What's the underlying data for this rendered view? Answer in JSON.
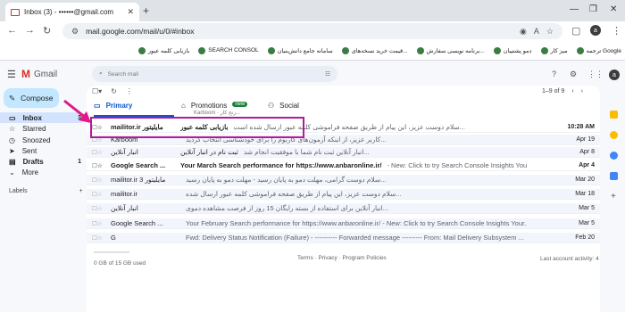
{
  "browser": {
    "tab_title": "Inbox (3) - ••••••@gmail.com",
    "url": "mail.google.com/mail/u/0/#inbox",
    "profile_initial": "a",
    "bookmarks": [
      "ترجمه Google",
      "میز کار",
      "دمو پشتیبان",
      "برنامه نویسی سفارش...",
      "قیمت خرید نسخه‌های...",
      "سامانه جامع دانش‌بنیان",
      "SEARCH CONSOL",
      "بازیابی کلمه عبور"
    ]
  },
  "gmail": {
    "logo_text": "Gmail",
    "search_placeholder": "Search mail",
    "compose": "Compose",
    "nav": [
      {
        "label": "Inbox",
        "count": "3"
      },
      {
        "label": "Starred",
        "count": ""
      },
      {
        "label": "Snoozed",
        "count": ""
      },
      {
        "label": "Sent",
        "count": ""
      },
      {
        "label": "Drafts",
        "count": "1"
      },
      {
        "label": "More",
        "count": ""
      }
    ],
    "labels_heading": "Labels",
    "labels_add": "+",
    "pager": "1–9 of 9",
    "tabs": {
      "primary": "Primary",
      "promotions": "Promotions",
      "promotions_badge": "new",
      "promotions_sub": "Karboom · رنج کار...",
      "social": "Social"
    },
    "emails": [
      {
        "sender": "mailitor.ir مایلیتور",
        "subject": "بازیابی کلمه عبور",
        "snippet": "سلام دوست عزیز، این پیام از طریق صفحه فراموشی کلمه عبور ارسال شده است...",
        "date": "10:28 AM",
        "unread": true
      },
      {
        "sender": "Karboom",
        "subject": "",
        "snippet": "کاربر عزیز، از اینکه آزمون‌های کاربوم را برای خودشناسی انتخاب کردید...",
        "date": "Apr 19",
        "unread": false
      },
      {
        "sender": "انبار آنلاین",
        "subject": "ثبت نام در انبار آنلاین",
        "snippet": "انبار آنلاین ثبت نام شما با موفقیت انجام شد...",
        "date": "Apr 8",
        "unread": false
      },
      {
        "sender": "Google Search ...",
        "subject": "Your March Search performance for https://www.anbaronline.ir/",
        "snippet": "- New: Click to try Search Console Insights Your...",
        "date": "Apr 4",
        "unread": true
      },
      {
        "sender": "mailitor.ir مایلیتور 3",
        "subject": "",
        "snippet": "سلام دوست گرامی، مهلت دمو به پایان رسید - مهلت دمو به پایان رسید...",
        "date": "Mar 20",
        "unread": false
      },
      {
        "sender": "mailitor.ir",
        "subject": "",
        "snippet": "سلام دوست عزیز، این پیام از طریق صفحه فراموشی کلمه عبور ارسال شده...",
        "date": "Mar 18",
        "unread": false
      },
      {
        "sender": "انبار آنلاین",
        "subject": "",
        "snippet": "انبار آنلاین برای استفاده از بسته رایگان 15 روز از فرصت مشاهده دموی...",
        "date": "Mar 5",
        "unread": false
      },
      {
        "sender": "Google Search ...",
        "subject": "",
        "snippet": "Your February Search performance for https://www.anbaronline.ir/ - New: Click to try Search Console Insights Your...",
        "date": "Mar 5",
        "unread": false
      },
      {
        "sender": "G",
        "subject": "",
        "snippet": "Fwd: Delivery Status Notification (Failure) - ---------- Forwarded message --------- From: Mail Delivery Subsystem ...",
        "date": "Feb 20",
        "unread": false
      }
    ],
    "footer": {
      "storage": "0 GB of 15 GB used",
      "links": "Terms · Privacy · Program Policies",
      "activity": "Last account activity: 4 days ago",
      "details": "Details"
    }
  },
  "colors": {
    "accent": "#0b57d0",
    "annotation": "#b5189a"
  }
}
